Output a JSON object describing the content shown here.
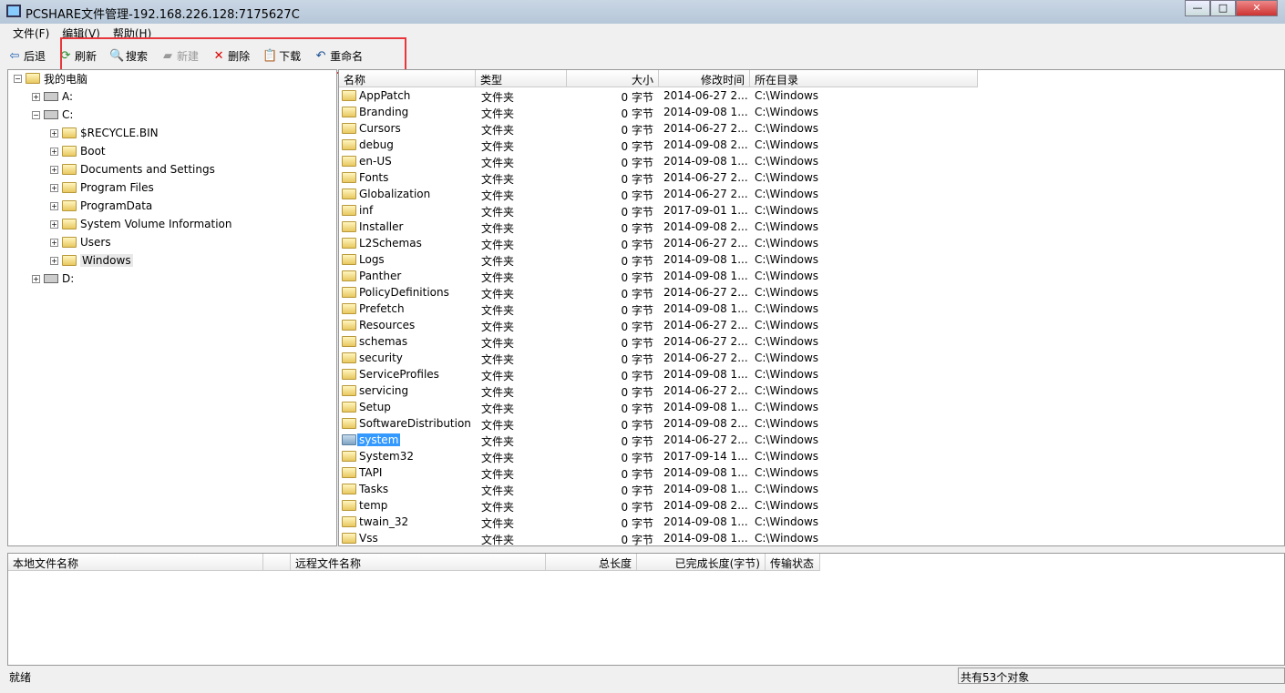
{
  "window": {
    "title": "PCSHARE文件管理-192.168.226.128:7175627C",
    "minimize": "—",
    "maximize": "□",
    "close": "✕"
  },
  "menu": [
    "文件(F)",
    "编辑(V)",
    "帮助(H)"
  ],
  "toolbar": {
    "back": "后退",
    "refresh": "刷新",
    "search": "搜索",
    "new": "新建",
    "delete": "删除",
    "download": "下载",
    "rename": "重命名"
  },
  "tree": [
    {
      "label": "我的电脑",
      "level": 0,
      "expander": "−",
      "icon": "computer"
    },
    {
      "label": "A:",
      "level": 1,
      "expander": "+",
      "icon": "drive"
    },
    {
      "label": "C:",
      "level": 1,
      "expander": "−",
      "icon": "drive"
    },
    {
      "label": "$RECYCLE.BIN",
      "level": 2,
      "expander": "+",
      "icon": "folder"
    },
    {
      "label": "Boot",
      "level": 2,
      "expander": "+",
      "icon": "folder"
    },
    {
      "label": "Documents and Settings",
      "level": 2,
      "expander": "+",
      "icon": "folder"
    },
    {
      "label": "Program Files",
      "level": 2,
      "expander": "+",
      "icon": "folder"
    },
    {
      "label": "ProgramData",
      "level": 2,
      "expander": "+",
      "icon": "folder"
    },
    {
      "label": "System Volume Information",
      "level": 2,
      "expander": "+",
      "icon": "folder"
    },
    {
      "label": "Users",
      "level": 2,
      "expander": "+",
      "icon": "folder"
    },
    {
      "label": "Windows",
      "level": 2,
      "expander": "+",
      "icon": "folder-open",
      "selected": true
    },
    {
      "label": "D:",
      "level": 1,
      "expander": "+",
      "icon": "drive"
    }
  ],
  "list": {
    "columns": [
      "名称",
      "类型",
      "大小",
      "修改时间",
      "所在目录"
    ],
    "rows": [
      [
        "AppPatch",
        "文件夹",
        "0 字节",
        "2014-06-27 2...",
        "C:\\Windows"
      ],
      [
        "Branding",
        "文件夹",
        "0 字节",
        "2014-09-08 1...",
        "C:\\Windows"
      ],
      [
        "Cursors",
        "文件夹",
        "0 字节",
        "2014-06-27 2...",
        "C:\\Windows"
      ],
      [
        "debug",
        "文件夹",
        "0 字节",
        "2014-09-08 2...",
        "C:\\Windows"
      ],
      [
        "en-US",
        "文件夹",
        "0 字节",
        "2014-09-08 1...",
        "C:\\Windows"
      ],
      [
        "Fonts",
        "文件夹",
        "0 字节",
        "2014-06-27 2...",
        "C:\\Windows"
      ],
      [
        "Globalization",
        "文件夹",
        "0 字节",
        "2014-06-27 2...",
        "C:\\Windows"
      ],
      [
        "inf",
        "文件夹",
        "0 字节",
        "2017-09-01 1...",
        "C:\\Windows"
      ],
      [
        "Installer",
        "文件夹",
        "0 字节",
        "2014-09-08 2...",
        "C:\\Windows"
      ],
      [
        "L2Schemas",
        "文件夹",
        "0 字节",
        "2014-06-27 2...",
        "C:\\Windows"
      ],
      [
        "Logs",
        "文件夹",
        "0 字节",
        "2014-09-08 1...",
        "C:\\Windows"
      ],
      [
        "Panther",
        "文件夹",
        "0 字节",
        "2014-09-08 1...",
        "C:\\Windows"
      ],
      [
        "PolicyDefinitions",
        "文件夹",
        "0 字节",
        "2014-06-27 2...",
        "C:\\Windows"
      ],
      [
        "Prefetch",
        "文件夹",
        "0 字节",
        "2014-09-08 1...",
        "C:\\Windows"
      ],
      [
        "Resources",
        "文件夹",
        "0 字节",
        "2014-06-27 2...",
        "C:\\Windows"
      ],
      [
        "schemas",
        "文件夹",
        "0 字节",
        "2014-06-27 2...",
        "C:\\Windows"
      ],
      [
        "security",
        "文件夹",
        "0 字节",
        "2014-06-27 2...",
        "C:\\Windows"
      ],
      [
        "ServiceProfiles",
        "文件夹",
        "0 字节",
        "2014-09-08 1...",
        "C:\\Windows"
      ],
      [
        "servicing",
        "文件夹",
        "0 字节",
        "2014-06-27 2...",
        "C:\\Windows"
      ],
      [
        "Setup",
        "文件夹",
        "0 字节",
        "2014-09-08 1...",
        "C:\\Windows"
      ],
      [
        "SoftwareDistribution",
        "文件夹",
        "0 字节",
        "2014-09-08 2...",
        "C:\\Windows"
      ],
      [
        "system",
        "文件夹",
        "0 字节",
        "2014-06-27 2...",
        "C:\\Windows"
      ],
      [
        "System32",
        "文件夹",
        "0 字节",
        "2017-09-14 1...",
        "C:\\Windows"
      ],
      [
        "TAPI",
        "文件夹",
        "0 字节",
        "2014-09-08 1...",
        "C:\\Windows"
      ],
      [
        "Tasks",
        "文件夹",
        "0 字节",
        "2014-09-08 1...",
        "C:\\Windows"
      ],
      [
        "temp",
        "文件夹",
        "0 字节",
        "2014-09-08 2...",
        "C:\\Windows"
      ],
      [
        "twain_32",
        "文件夹",
        "0 字节",
        "2014-09-08 1...",
        "C:\\Windows"
      ],
      [
        "Vss",
        "文件夹",
        "0 字节",
        "2014-09-08 1...",
        "C:\\Windows"
      ]
    ],
    "selected_name": "system"
  },
  "transfer": {
    "columns": [
      "本地文件名称",
      "",
      "远程文件名称",
      "总长度",
      "已完成长度(字节)",
      "传输状态"
    ]
  },
  "status": {
    "left": "就绪",
    "right": "共有53个对象"
  },
  "colors": {
    "highlight": "#3399ff",
    "annotation": "#e8373c"
  }
}
